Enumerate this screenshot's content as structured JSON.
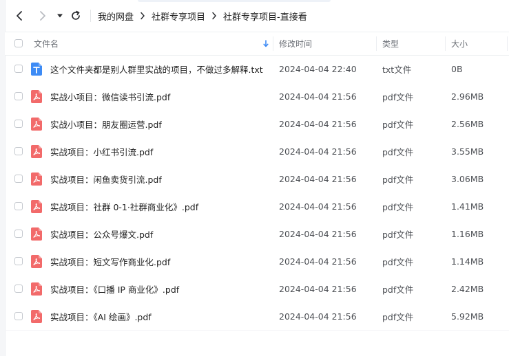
{
  "breadcrumb": [
    {
      "label": "我的网盘"
    },
    {
      "label": "社群专享项目"
    },
    {
      "label": "社群专享项目-直接看"
    }
  ],
  "table": {
    "columns": {
      "name": "文件名",
      "date": "修改时间",
      "type": "类型",
      "size": "大小"
    },
    "sort_column": "name",
    "rows": [
      {
        "name": "这个文件夹都是别人群里实战的项目，不做过多解释.txt",
        "date": "2024-04-04 22:40",
        "type": "txt文件",
        "size": "0B",
        "icon": "txt-file-icon"
      },
      {
        "name": "实战小项目：微信读书引流.pdf",
        "date": "2024-04-04 21:56",
        "type": "pdf文件",
        "size": "2.96MB",
        "icon": "pdf-file-icon"
      },
      {
        "name": "实战小项目：朋友圈运营.pdf",
        "date": "2024-04-04 21:56",
        "type": "pdf文件",
        "size": "2.56MB",
        "icon": "pdf-file-icon"
      },
      {
        "name": "实战项目：小红书引流.pdf",
        "date": "2024-04-04 21:56",
        "type": "pdf文件",
        "size": "3.55MB",
        "icon": "pdf-file-icon"
      },
      {
        "name": "实战项目：闲鱼卖货引流.pdf",
        "date": "2024-04-04 21:56",
        "type": "pdf文件",
        "size": "3.06MB",
        "icon": "pdf-file-icon"
      },
      {
        "name": "实战项目：社群 0-1·社群商业化》.pdf",
        "date": "2024-04-04 21:56",
        "type": "pdf文件",
        "size": "1.41MB",
        "icon": "pdf-file-icon"
      },
      {
        "name": "实战项目：公众号爆文.pdf",
        "date": "2024-04-04 21:56",
        "type": "pdf文件",
        "size": "1.16MB",
        "icon": "pdf-file-icon"
      },
      {
        "name": "实战项目：短文写作商业化.pdf",
        "date": "2024-04-04 21:56",
        "type": "pdf文件",
        "size": "1.14MB",
        "icon": "pdf-file-icon"
      },
      {
        "name": "实战项目：《口播 IP 商业化》.pdf",
        "date": "2024-04-04 21:56",
        "type": "pdf文件",
        "size": "2.42MB",
        "icon": "pdf-file-icon"
      },
      {
        "name": "实战项目：《AI 绘画》.pdf",
        "date": "2024-04-04 21:56",
        "type": "pdf文件",
        "size": "5.92MB",
        "icon": "pdf-file-icon"
      }
    ]
  },
  "colors": {
    "pdf_icon": "#f26a6a",
    "txt_icon": "#3d8bf5",
    "sort_arrow": "#3d8bf5"
  }
}
